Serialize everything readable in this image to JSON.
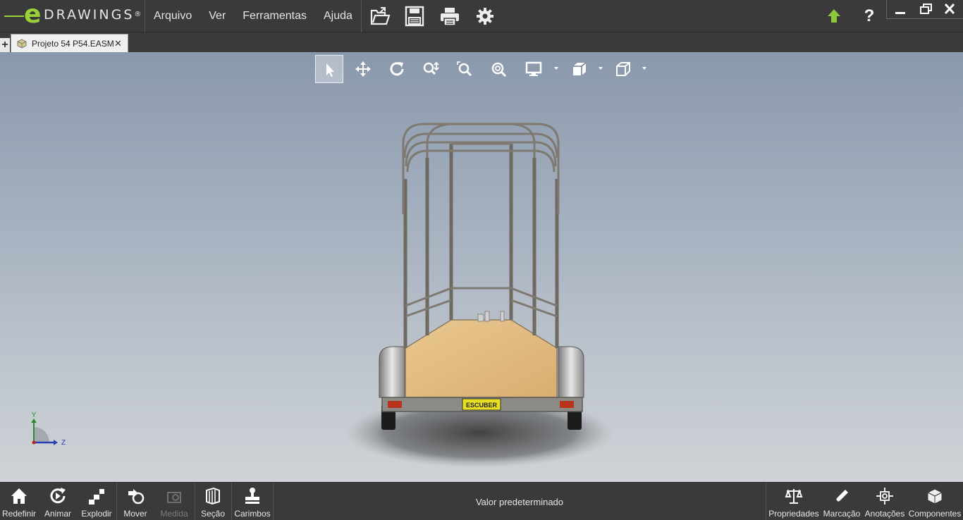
{
  "app": {
    "logo_letter": "e",
    "logo_text": "DRAWINGS",
    "logo_mark": "®"
  },
  "menu": {
    "items": [
      {
        "label": "Arquivo"
      },
      {
        "label": "Ver"
      },
      {
        "label": "Ferramentas"
      },
      {
        "label": "Ajuda"
      }
    ]
  },
  "toolbar_icons": [
    "open-file-icon",
    "save-icon",
    "print-icon",
    "gear-icon"
  ],
  "right_icons": [
    "update-arrow-icon",
    "help-icon"
  ],
  "help_glyph": "?",
  "window_controls": [
    "minimize-icon",
    "restore-icon",
    "close-icon"
  ],
  "tabs": {
    "add_glyph": "+",
    "document": {
      "label": "Projeto 54 P54.EASM",
      "close_glyph": "✕"
    }
  },
  "view_toolbar": [
    {
      "name": "select-tool",
      "icon": "pointer-icon",
      "active": true
    },
    {
      "name": "pan-tool",
      "icon": "move-arrows-icon"
    },
    {
      "name": "rotate-tool",
      "icon": "rotate-icon"
    },
    {
      "name": "zoom-tool",
      "icon": "zoom-icon"
    },
    {
      "name": "zoom-area-tool",
      "icon": "zoom-area-icon"
    },
    {
      "name": "zoom-fit-tool",
      "icon": "zoom-fit-icon"
    },
    {
      "name": "display-style-tool",
      "icon": "monitor-icon",
      "dropdown": true
    },
    {
      "name": "view-orientation-tool",
      "icon": "cube-views-icon",
      "dropdown": true
    },
    {
      "name": "standard-views-tool",
      "icon": "cube-icon",
      "dropdown": true
    }
  ],
  "model": {
    "plate_text": "ESCUBER",
    "colors": {
      "frame": "#6e6a62",
      "wood": "#e3bb85",
      "plate": "#e6e020",
      "light": "#b8341c"
    }
  },
  "triad": {
    "y_label": "Y",
    "z_label": "Z"
  },
  "bottom_bar": {
    "left_tools": [
      {
        "label": "Redefinir",
        "icon": "home-icon"
      },
      {
        "label": "Animar",
        "icon": "animate-icon"
      },
      {
        "label": "Explodir",
        "icon": "explode-icon"
      },
      {
        "label": "Mover",
        "icon": "move-component-icon"
      },
      {
        "label": "Medida",
        "icon": "measure-icon",
        "disabled": true
      },
      {
        "label": "Seção",
        "icon": "section-icon"
      },
      {
        "label": "Carimbos",
        "icon": "stamp-icon"
      }
    ],
    "status": "Valor predeterminado",
    "right_tools": [
      {
        "label": "Propriedades",
        "icon": "scale-icon"
      },
      {
        "label": "Marcação",
        "icon": "pencil-icon"
      },
      {
        "label": "Anotações",
        "icon": "annotation-icon"
      },
      {
        "label": "Componentes",
        "icon": "components-icon"
      }
    ]
  }
}
